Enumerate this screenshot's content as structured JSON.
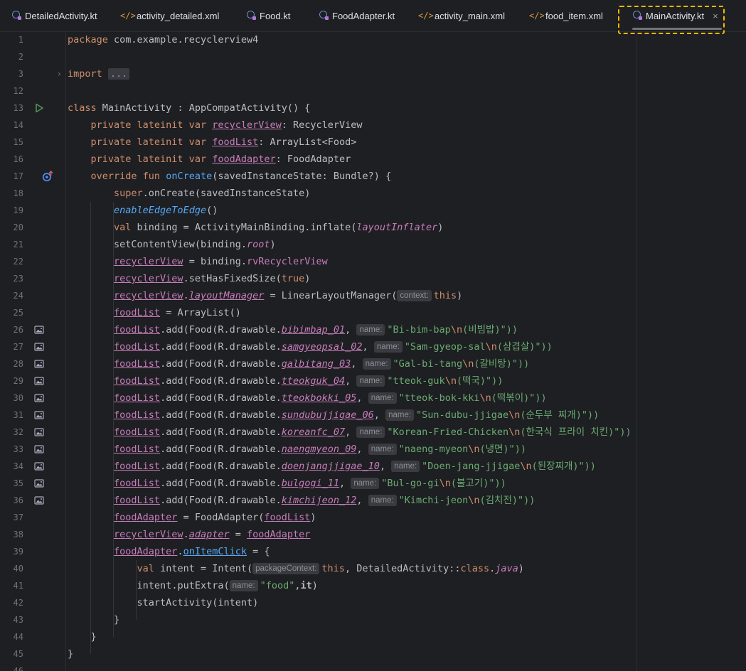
{
  "tabs": [
    {
      "label": "DetailedActivity.kt",
      "icon": "kotlin-file-icon"
    },
    {
      "label": "activity_detailed.xml",
      "icon": "xml-file-icon"
    },
    {
      "label": "Food.kt",
      "icon": "kotlin-file-icon"
    },
    {
      "label": "FoodAdapter.kt",
      "icon": "kotlin-file-icon"
    },
    {
      "label": "activity_main.xml",
      "icon": "xml-file-icon"
    },
    {
      "label": "food_item.xml",
      "icon": "xml-file-icon"
    },
    {
      "label": "MainActivity.kt",
      "icon": "kotlin-file-icon",
      "active": true,
      "close": "×"
    }
  ],
  "hints": {
    "context": "context:",
    "name": "name:",
    "packageContext": "packageContext:"
  },
  "lines": [
    {
      "n": "1"
    },
    {
      "n": "2"
    },
    {
      "n": "3"
    },
    {
      "n": "12"
    },
    {
      "n": "13"
    },
    {
      "n": "14"
    },
    {
      "n": "15"
    },
    {
      "n": "16"
    },
    {
      "n": "17"
    },
    {
      "n": "18"
    },
    {
      "n": "19"
    },
    {
      "n": "20"
    },
    {
      "n": "21"
    },
    {
      "n": "22"
    },
    {
      "n": "23"
    },
    {
      "n": "24"
    },
    {
      "n": "25"
    },
    {
      "n": "26"
    },
    {
      "n": "27"
    },
    {
      "n": "28"
    },
    {
      "n": "29"
    },
    {
      "n": "30"
    },
    {
      "n": "31"
    },
    {
      "n": "32"
    },
    {
      "n": "33"
    },
    {
      "n": "34"
    },
    {
      "n": "35"
    },
    {
      "n": "36"
    },
    {
      "n": "37"
    },
    {
      "n": "38"
    },
    {
      "n": "39"
    },
    {
      "n": "40"
    },
    {
      "n": "41"
    },
    {
      "n": "42"
    },
    {
      "n": "43"
    },
    {
      "n": "44"
    },
    {
      "n": "45"
    },
    {
      "n": "46"
    }
  ],
  "code": {
    "package_kw": "package",
    "package_name": "com.example.recyclerview4",
    "import_kw": "import",
    "import_fold": "...",
    "class_kw": "class",
    "class_decl": "MainActivity : AppCompatActivity() {",
    "private_lateinit_var": "private lateinit var",
    "recyclerView": "recyclerView",
    "recyclerView_type": ": RecyclerView",
    "foodList": "foodList",
    "foodList_type": ": ArrayList<Food>",
    "foodAdapter": "foodAdapter",
    "foodAdapter_type": ": FoodAdapter",
    "override_fun": "override fun",
    "onCreate": "onCreate",
    "onCreate_params": "(savedInstanceState: Bundle?) {",
    "super": "super",
    "super_call": ".onCreate(savedInstanceState)",
    "enableEdgeToEdge": "enableEdgeToEdge",
    "parens": "()",
    "val": "val",
    "binding_decl": " binding = ActivityMainBinding.inflate(",
    "layoutInflater": "layoutInflater",
    "close_paren": ")",
    "setContentView": "setContentView(binding.",
    "root": "root",
    "assign_binding": " = binding.",
    "rvRecyclerView": "rvRecyclerView",
    "setHasFixedSize": ".setHasFixedSize(",
    "true_kw": "true",
    "dot": ".",
    "layoutManager": "layoutManager",
    "lm_assign": " = LinearLayoutManager(",
    "this_kw": "this",
    "arraylist_assign": " = ArrayList()",
    "add_prefix": ".add(Food(R.drawable.",
    "foods": [
      {
        "drawable": "bibimbap_01",
        "name_pre": "\"Bi-bim-bap",
        "escape": "\\n",
        "name_post": "(비빔밥)\"))"
      },
      {
        "drawable": "samgyeopsal_02",
        "name_pre": "\"Sam-gyeop-sal",
        "escape": "\\n",
        "name_post": "(삼겹살)\"))"
      },
      {
        "drawable": "galbitang_03",
        "name_pre": "\"Gal-bi-tang",
        "escape": "\\n",
        "name_post": "(갈비탕)\"))"
      },
      {
        "drawable": "tteokguk_04",
        "name_pre": "\"tteok-guk",
        "escape": "\\n",
        "name_post": "(떡국)\"))"
      },
      {
        "drawable": "tteokbokki_05",
        "name_pre": "\"tteok-bok-kki",
        "escape": "\\n",
        "name_post": "(떡볶이)\"))"
      },
      {
        "drawable": "sundubujjigae_06",
        "name_pre": "\"Sun-dubu-jjigae",
        "escape": "\\n",
        "name_post": "(순두부 찌개)\"))"
      },
      {
        "drawable": "koreanfc_07",
        "name_pre": "\"Korean-Fried-Chicken",
        "escape": "\\n",
        "name_post": "(한국식 프라이 치킨)\"))"
      },
      {
        "drawable": "naengmyeon_09",
        "name_pre": "\"naeng-myeon",
        "escape": "\\n",
        "name_post": "(냉면)\"))"
      },
      {
        "drawable": "doenjangjjigae_10",
        "name_pre": "\"Doen-jang-jjigae",
        "escape": "\\n",
        "name_post": "(된장찌개)\"))"
      },
      {
        "drawable": "bulgogi_11",
        "name_pre": "\"Bul-go-gi",
        "escape": "\\n",
        "name_post": "(불고기)\"))"
      },
      {
        "drawable": "kimchijeon_12",
        "name_pre": "\"Kimchi-jeon",
        "escape": "\\n",
        "name_post": "(김치전)\"))"
      }
    ],
    "adapter_assign": " = FoodAdapter(",
    "adapter": "adapter",
    "assign": " = ",
    "onItemClick": "onItemClick",
    "lambda_open": " = {",
    "intent_decl": " intent = Intent(",
    "this_sep": ", DetailedActivity::",
    "class_kw2": "class",
    "java": "java",
    "putExtra": "intent.putExtra(",
    "food_str": "\"food\"",
    "comma": ",",
    "it": "it",
    "startActivity": "startActivity(intent)",
    "close_brace": "}"
  }
}
